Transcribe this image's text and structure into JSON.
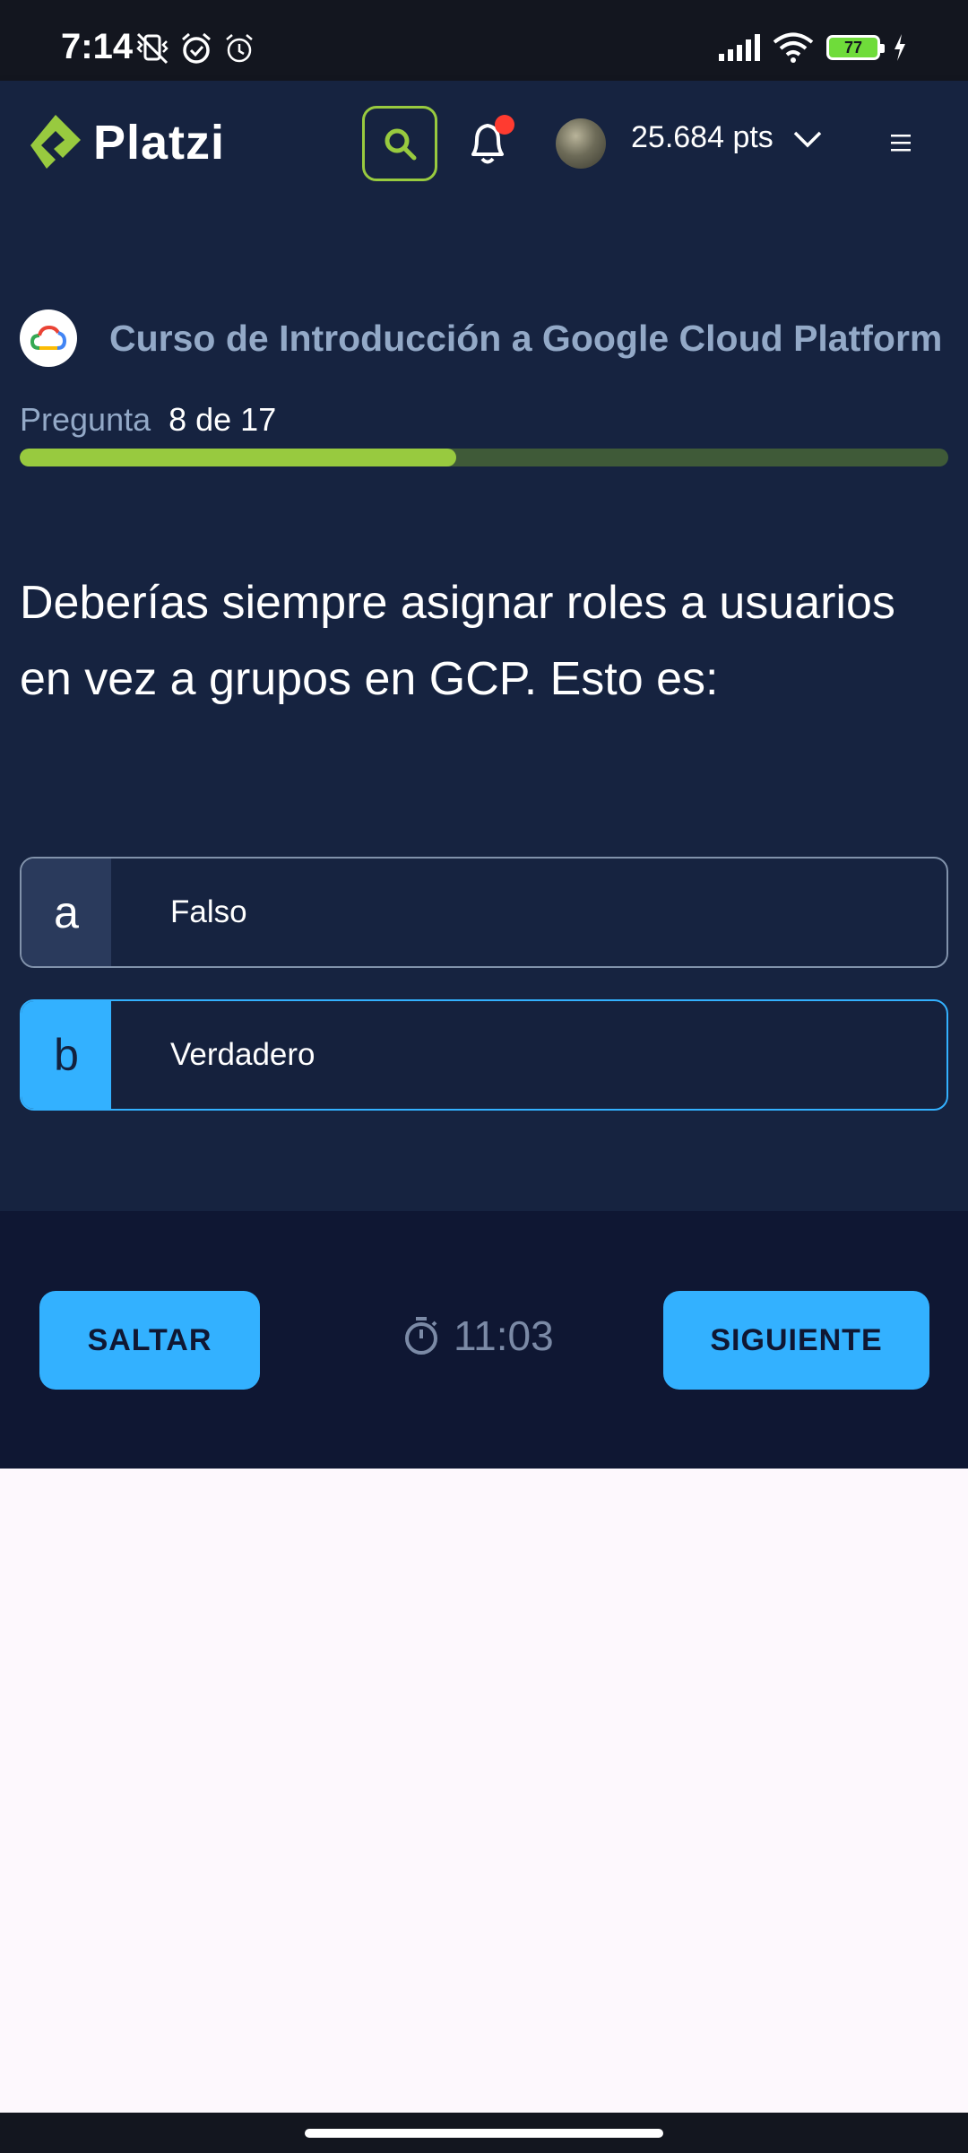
{
  "status_bar": {
    "time": "7:14",
    "battery": "77"
  },
  "header": {
    "logo_text": "Platzi",
    "points": "25.684 pts"
  },
  "course": {
    "title": "Curso de Introducción a Google Cloud Platform"
  },
  "progress": {
    "label": "Pregunta",
    "value": "8 de 17",
    "fraction": 0.47
  },
  "question": {
    "text": "Deberías siempre asignar roles a usuarios en vez a grupos en GCP. Esto es:"
  },
  "options": [
    {
      "letter": "a",
      "text": "Falso",
      "selected": false
    },
    {
      "letter": "b",
      "text": "Verdadero",
      "selected": true
    }
  ],
  "footer": {
    "skip_label": "SALTAR",
    "timer": "11:03",
    "next_label": "SIGUIENTE"
  },
  "colors": {
    "accent_green": "#98ca3f",
    "accent_blue": "#33b1ff",
    "bg_navy": "#162340"
  }
}
